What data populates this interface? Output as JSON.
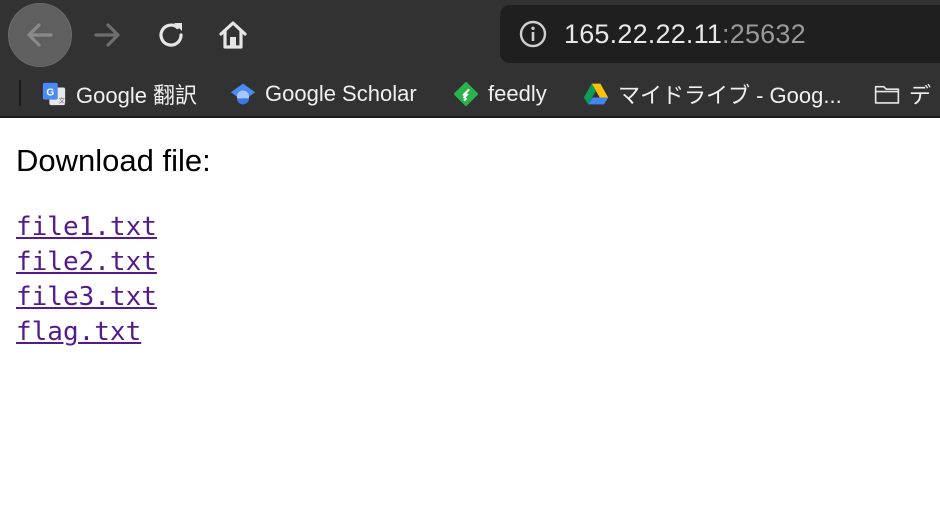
{
  "browser": {
    "url_host": "165.22.22.11",
    "url_port": ":25632",
    "bookmarks": [
      {
        "label": "Google 翻訳",
        "icon": "google-translate-icon"
      },
      {
        "label": "Google Scholar",
        "icon": "google-scholar-icon"
      },
      {
        "label": "feedly",
        "icon": "feedly-icon"
      },
      {
        "label": "マイドライブ - Goog...",
        "icon": "google-drive-icon"
      },
      {
        "label": "デ",
        "icon": "folder-icon"
      }
    ]
  },
  "page": {
    "heading": "Download file:",
    "files": [
      "file1.txt",
      "file2.txt",
      "file3.txt",
      "flag.txt"
    ],
    "link_color": "#551a8b"
  }
}
